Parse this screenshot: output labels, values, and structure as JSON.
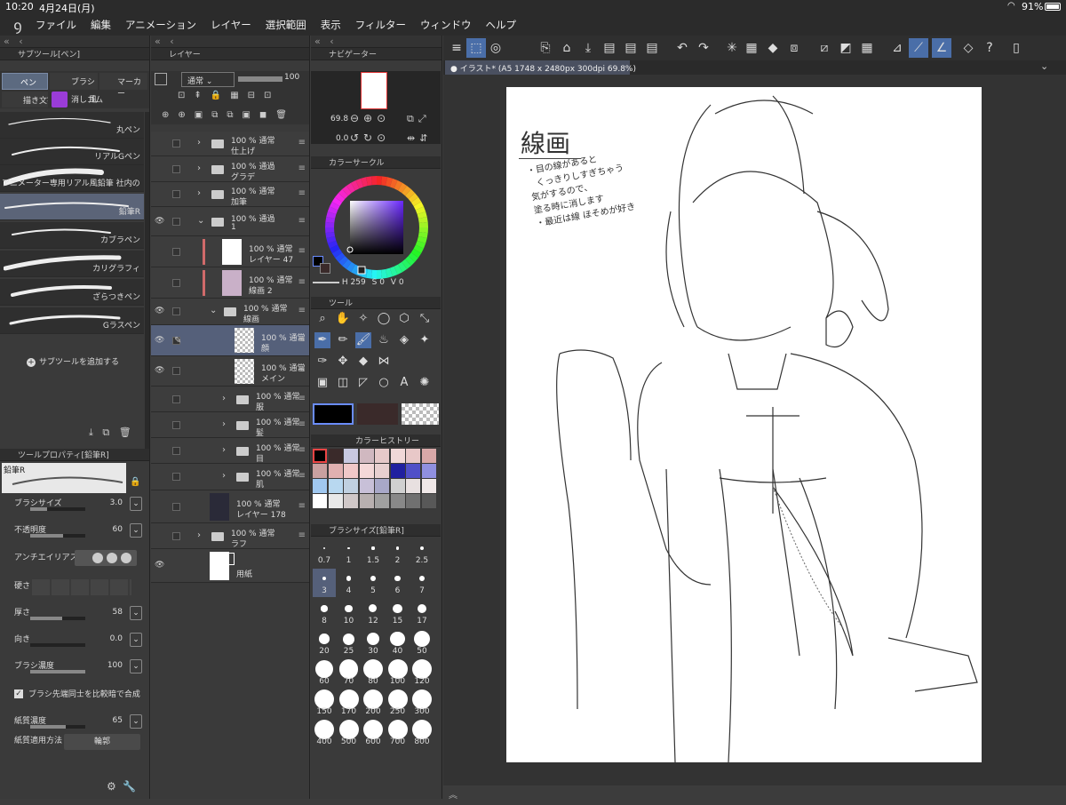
{
  "status": {
    "time": "10:20",
    "date": "4月24日(月)",
    "battery": "91%"
  },
  "menu": [
    "ファイル",
    "編集",
    "アニメーション",
    "レイヤー",
    "選択範囲",
    "表示",
    "フィルター",
    "ウィンドウ",
    "ヘルプ"
  ],
  "subtool": {
    "title": "サブツール[ペン]",
    "tabs": [
      "ペン",
      "ブラシ",
      "マーカー"
    ],
    "tabs2": [
      "描き文字",
      "消しゴム",
      "風"
    ],
    "brushes": [
      "丸ペン",
      "リアルGペン",
      "アニメーター専用リアル風鉛筆 社内の",
      "鉛筆R",
      "カブラペン",
      "カリグラフィ",
      "ざらつきペン",
      "Gラスペン"
    ],
    "add_label": "サブツールを追加する"
  },
  "toolprop": {
    "title": "ツールプロパティ[鉛筆R]",
    "preview_name": "鉛筆R",
    "rows": [
      {
        "label": "ブラシサイズ",
        "value": "3.0",
        "level": 0.3
      },
      {
        "label": "不透明度",
        "value": "60",
        "level": 0.6
      },
      {
        "label": "アンチエイリアス",
        "value": ""
      },
      {
        "label": "硬さ",
        "value": ""
      },
      {
        "label": "厚さ",
        "value": "58",
        "level": 0.58
      },
      {
        "label": "向き",
        "value": "0.0",
        "level": 0.0
      },
      {
        "label": "ブラシ濃度",
        "value": "100",
        "level": 1.0
      },
      {
        "label": "ブラシ先端同士を比較暗で合成",
        "value": ""
      },
      {
        "label": "紙質濃度",
        "value": "65",
        "level": 0.65
      },
      {
        "label": "紙質適用方法",
        "value": "輪郭"
      }
    ]
  },
  "layer": {
    "title": "レイヤー",
    "blend": "通常",
    "opacity": "100",
    "items": [
      {
        "pct": "100 %",
        "mode": "通常",
        "name": "仕上げ"
      },
      {
        "pct": "100 %",
        "mode": "通過",
        "name": "グラデ"
      },
      {
        "pct": "100 %",
        "mode": "通常",
        "name": "加筆"
      },
      {
        "pct": "100 %",
        "mode": "通過",
        "name": "1"
      },
      {
        "pct": "100 %",
        "mode": "通常",
        "name": "レイヤー 47"
      },
      {
        "pct": "100 %",
        "mode": "通常",
        "name": "線画 2"
      },
      {
        "pct": "100 %",
        "mode": "通常",
        "name": "線画"
      },
      {
        "pct": "100 %",
        "mode": "通常",
        "name": "顔"
      },
      {
        "pct": "100 %",
        "mode": "通常",
        "name": "メイン"
      },
      {
        "pct": "100 %",
        "mode": "通常",
        "name": "服"
      },
      {
        "pct": "100 %",
        "mode": "通常",
        "name": "髪"
      },
      {
        "pct": "100 %",
        "mode": "通常",
        "name": "目"
      },
      {
        "pct": "100 %",
        "mode": "通常",
        "name": "肌"
      },
      {
        "pct": "100 %",
        "mode": "通常",
        "name": "レイヤー 178"
      },
      {
        "pct": "100 %",
        "mode": "通常",
        "name": "ラフ"
      },
      {
        "pct": "",
        "mode": "",
        "name": "用紙"
      }
    ]
  },
  "navigator": {
    "title": "ナビゲーター",
    "zoom": "69.8",
    "angle": "0.0"
  },
  "colorcircle": {
    "title": "カラーサークル",
    "h": "259",
    "s": "0",
    "v": "0",
    "h_label": "H",
    "s_label": "S",
    "v_label": "V"
  },
  "tool": {
    "title": "ツール"
  },
  "history": {
    "title": "カラーヒストリー",
    "colors": [
      "#000000",
      "#3a2a2a",
      "#c8c8e0",
      "#d0b8c0",
      "#e6c9c9",
      "#f0d8d8",
      "#e8c8c8",
      "#d8a8a8",
      "#c8a0a0",
      "#e0b0b0",
      "#f0c8c8",
      "#f4d8d8",
      "#e8d0d0",
      "#2020a0",
      "#5050c8",
      "#9090e0",
      "#a0c8f0",
      "#b8d8f0",
      "#c0d0e0",
      "#c8c0d8",
      "#a8a8c8",
      "#d0d0d0",
      "#e8e0e0",
      "#f0e8e8",
      "#ffffff",
      "#e8e8e8",
      "#d0c8c8",
      "#b8b0b0",
      "#a0a0a0",
      "#888888",
      "#707070",
      "#585858"
    ]
  },
  "brushsize": {
    "title": "ブラシサイズ[鉛筆R]",
    "sizes": [
      "0.7",
      "1",
      "1.5",
      "2",
      "2.5",
      "3",
      "4",
      "5",
      "6",
      "7",
      "8",
      "10",
      "12",
      "15",
      "17",
      "20",
      "25",
      "30",
      "40",
      "50",
      "60",
      "70",
      "80",
      "100",
      "120",
      "150",
      "170",
      "200",
      "250",
      "300",
      "400",
      "500",
      "600",
      "700",
      "800"
    ]
  },
  "canvas": {
    "tab": "イラスト* (A5 1748 x 2480px 300dpi 69.8%)",
    "note_title": "線画",
    "note_lines": [
      "・目の線があると",
      "くっきりしすぎちゃう",
      "気がするので、",
      "塗る時に消します",
      "・最近は線 ほそめが好き"
    ]
  }
}
